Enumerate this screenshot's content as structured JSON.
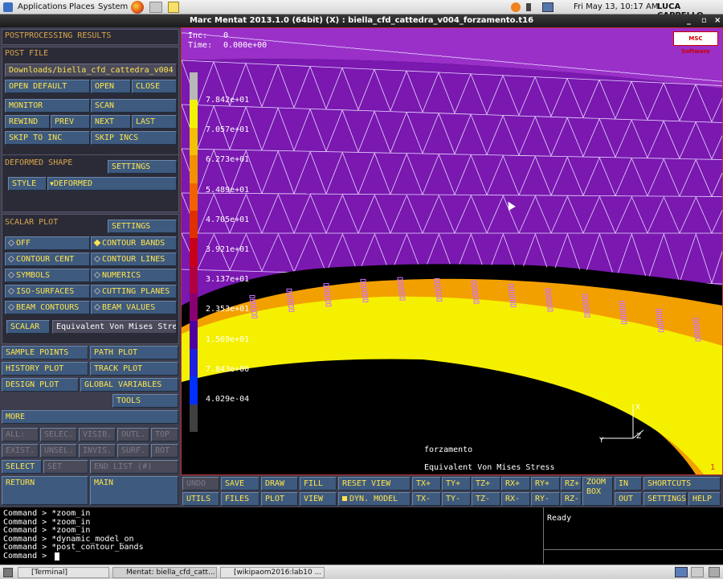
{
  "topbar": {
    "applications": "Applications",
    "places": "Places",
    "system": "System",
    "datetime": "Fri May 13, 10:17 AM",
    "user": "LUCA CAPPELLO"
  },
  "window": {
    "title": "Marc Mentat 2013.1.0 (64bit) (X) : biella_cfd_cattedra_v004_forzamento.t16"
  },
  "panel": {
    "title": "POSTPROCESSING RESULTS",
    "post_file": {
      "header": "POST FILE",
      "path": "Downloads/biella_cfd_cattedra_v004",
      "open_default": "OPEN DEFAULT",
      "open": "OPEN",
      "close": "CLOSE",
      "monitor": "MONITOR",
      "scan": "SCAN",
      "rewind": "REWIND",
      "prev": "PREV",
      "next": "NEXT",
      "last": "LAST",
      "skip_to_inc": "SKIP TO INC",
      "skip_incs": "SKIP INCS"
    },
    "deformed": {
      "header": "DEFORMED SHAPE",
      "settings": "SETTINGS",
      "style_label": "STYLE",
      "style_value": "DEFORMED"
    },
    "scalar_plot": {
      "header": "SCALAR PLOT",
      "settings": "SETTINGS",
      "off": "OFF",
      "contour_bands": "CONTOUR BANDS",
      "contour_cent": "CONTOUR CENT",
      "contour_lines": "CONTOUR LINES",
      "symbols": "SYMBOLS",
      "numerics": "NUMERICS",
      "iso_surfaces": "ISO-SURFACES",
      "cutting_planes": "CUTTING PLANES",
      "beam_contours": "BEAM CONTOURS",
      "beam_values": "BEAM VALUES",
      "scalar_label": "SCALAR",
      "scalar_value": "Equivalent Von Mises Stress"
    },
    "misc": {
      "sample_points": "SAMPLE POINTS",
      "path_plot": "PATH PLOT",
      "history_plot": "HISTORY PLOT",
      "track_plot": "TRACK PLOT",
      "design_plot": "DESIGN PLOT",
      "global_variables": "GLOBAL VARIABLES",
      "tools": "TOOLS",
      "more": "MORE"
    },
    "select": {
      "all": "ALL:",
      "selec": "SELEC.",
      "visib": "VISIB.",
      "outl": "OUTL.",
      "top": "TOP",
      "exist": "EXIST.",
      "unsel": "UNSEL.",
      "invis": "INVIS.",
      "surf": "SURF.",
      "bot": "BOT",
      "select": "SELECT",
      "set": "SET",
      "end_list": "END LIST (#)"
    },
    "return": "RETURN",
    "main": "MAIN"
  },
  "viewport": {
    "inc_label": "Inc:",
    "inc_value": "0",
    "time_label": "Time:",
    "time_value": "0.000e+00",
    "logo_msc": "MSC",
    "logo_software": "Software",
    "legend": [
      "7.842e+01",
      "7.057e+01",
      "6.273e+01",
      "5.489e+01",
      "4.705e+01",
      "3.921e+01",
      "3.137e+01",
      "2.353e+01",
      "1.569e+01",
      "7.843e+00",
      "4.029e-04"
    ],
    "legend_colors": [
      "#b8b8b8",
      "#f2f200",
      "#f2c000",
      "#f29000",
      "#f26000",
      "#e03000",
      "#c80018",
      "#b00040",
      "#8a0070",
      "#5000a0",
      "#2020e0",
      "#0030ff",
      "#404040"
    ],
    "job_name": "forzamento",
    "quantity": "Equivalent Von Mises Stress",
    "corner_number": "1",
    "axis_y": "Y",
    "axis_z": "Z",
    "axis_x": "X"
  },
  "toolbar": {
    "undo": "UNDO",
    "save": "SAVE",
    "draw": "DRAW",
    "fill": "FILL",
    "reset_view": "RESET VIEW",
    "txp": "TX+",
    "typ": "TY+",
    "tzp": "TZ+",
    "rxp": "RX+",
    "ryp": "RY+",
    "rzp": "RZ+",
    "zoom_box": "ZOOM BOX",
    "in": "IN",
    "shortcuts": "SHORTCUTS",
    "utils": "UTILS",
    "files": "FILES",
    "plot": "PLOT",
    "view": "VIEW",
    "dyn_model": "DYN. MODEL",
    "txm": "TX-",
    "tym": "TY-",
    "tzm": "TZ-",
    "rxm": "RX-",
    "rym": "RY-",
    "rzm": "RZ-",
    "out": "OUT",
    "settings": "SETTINGS",
    "help": "HELP"
  },
  "console": {
    "lines": [
      "Command > *zoom_in",
      "Command > *zoom_in",
      "Command > *zoom_in",
      "Command > *dynamic_model_on",
      "Command > *post_contour_bands",
      "Command >"
    ],
    "status": "Ready"
  },
  "taskbar": {
    "terminal": "[Terminal]",
    "mentat": "Mentat: biella_cfd_catt...",
    "browser": "[wikipaom2016:lab10 ..."
  }
}
